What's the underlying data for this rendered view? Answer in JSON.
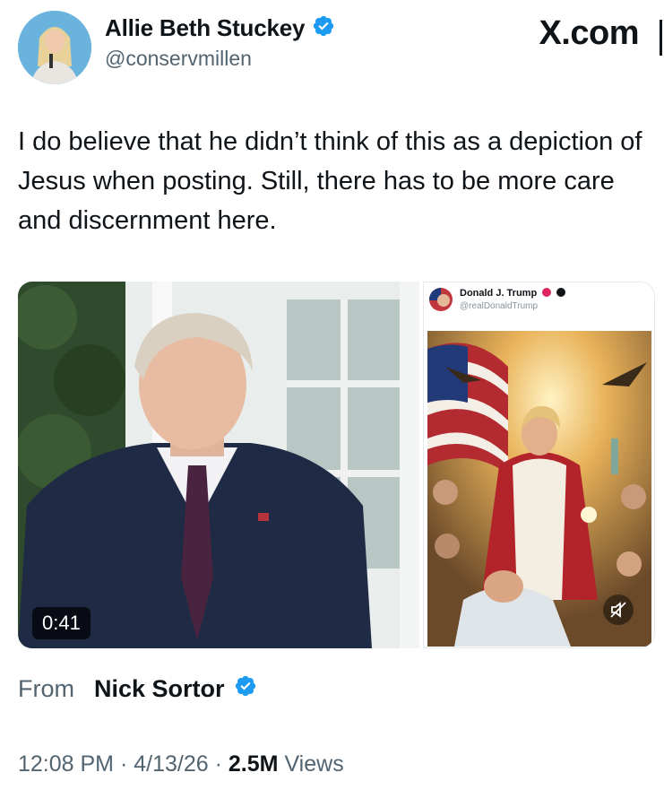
{
  "author": {
    "name": "Allie Beth Stuckey",
    "handle": "@conservmillen",
    "verified": true
  },
  "site_label": "X.com",
  "tweet": {
    "text": "I do believe that he didn’t think of this as a depiction of Jesus when posting. Still, there has to be more care and discernment here."
  },
  "media": {
    "video_duration": "0:41",
    "embedded_post": {
      "name": "Donald J. Trump",
      "handle": "@realDonaldTrump"
    }
  },
  "attribution": {
    "from_label": "From",
    "from_name": "Nick Sortor"
  },
  "meta": {
    "time": "12:08 PM",
    "separator": "·",
    "date": "4/13/26",
    "views_count": "2.5M",
    "views_label": "Views"
  },
  "colors": {
    "verified_blue": "#1d9bf0",
    "secondary_text": "#536471",
    "primary_text": "#0f1419"
  }
}
